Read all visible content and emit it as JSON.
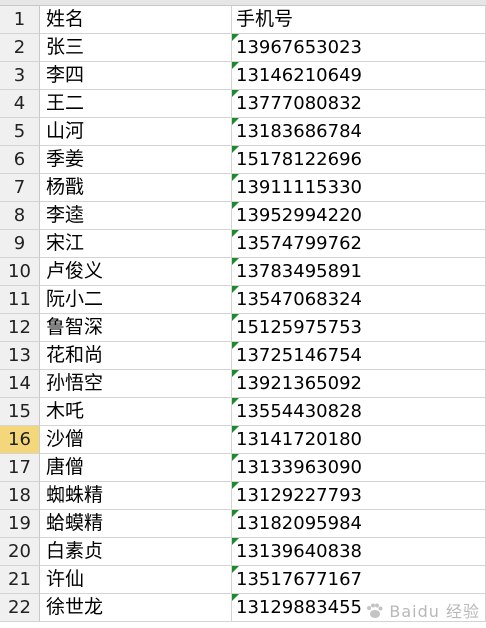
{
  "header": {
    "row_number": "1",
    "col_a": "姓名",
    "col_b": "手机号"
  },
  "selected_row": "16",
  "rows": [
    {
      "num": "2",
      "name": "张三",
      "phone": "13967653023"
    },
    {
      "num": "3",
      "name": "李四",
      "phone": "13146210649"
    },
    {
      "num": "4",
      "name": "王二",
      "phone": "13777080832"
    },
    {
      "num": "5",
      "name": "山河",
      "phone": "13183686784"
    },
    {
      "num": "6",
      "name": "季姜",
      "phone": "15178122696"
    },
    {
      "num": "7",
      "name": "杨戬",
      "phone": "13911115330"
    },
    {
      "num": "8",
      "name": "李逵",
      "phone": "13952994220"
    },
    {
      "num": "9",
      "name": "宋江",
      "phone": "13574799762"
    },
    {
      "num": "10",
      "name": "卢俊义",
      "phone": "13783495891"
    },
    {
      "num": "11",
      "name": "阮小二",
      "phone": "13547068324"
    },
    {
      "num": "12",
      "name": "鲁智深",
      "phone": "15125975753"
    },
    {
      "num": "13",
      "name": "花和尚",
      "phone": "13725146754"
    },
    {
      "num": "14",
      "name": "孙悟空",
      "phone": "13921365092"
    },
    {
      "num": "15",
      "name": "木吒",
      "phone": "13554430828"
    },
    {
      "num": "16",
      "name": "沙僧",
      "phone": "13141720180"
    },
    {
      "num": "17",
      "name": "唐僧",
      "phone": "13133963090"
    },
    {
      "num": "18",
      "name": "蜘蛛精",
      "phone": "13129227793"
    },
    {
      "num": "19",
      "name": "蛤蟆精",
      "phone": "13182095984"
    },
    {
      "num": "20",
      "name": "白素贞",
      "phone": "13139640838"
    },
    {
      "num": "21",
      "name": "许仙",
      "phone": "13517677167"
    },
    {
      "num": "22",
      "name": "徐世龙",
      "phone": "13129883455"
    }
  ],
  "watermark": "Baidu 经验",
  "colors": {
    "selected_row_header": "#f5d77b",
    "number_as_text_marker": "#1e8a2e"
  }
}
